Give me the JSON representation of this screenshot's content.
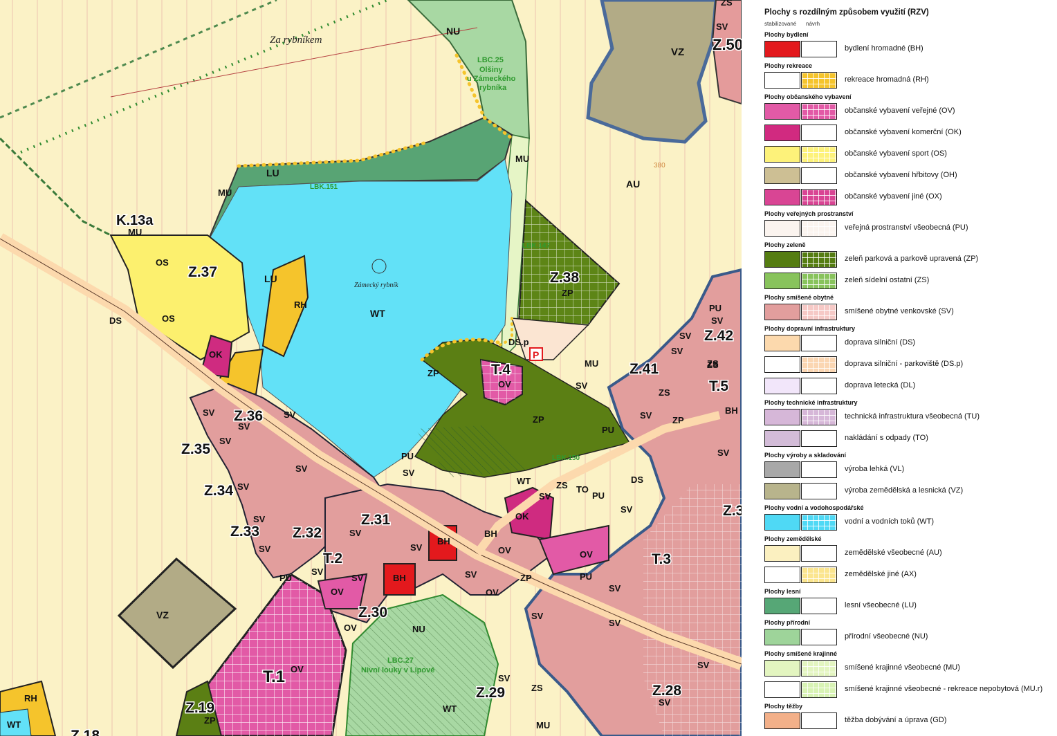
{
  "map": {
    "labels": {
      "za_rybnikem": "Za rybníkem",
      "nu_top": "NU",
      "lbc25": "LBC.25",
      "lbc25_name1": "Olšiny",
      "lbc25_name2": "u Zámeckého",
      "lbc25_name3": "rybníka",
      "vz_top": "VZ",
      "z50": "Z.50",
      "sv_top1": "SV",
      "zs_top": "ZS",
      "mu_1": "MU",
      "mu_2": "MU",
      "mu_3": "MU",
      "mu_4": "MU",
      "lu_1": "LU",
      "lu_2": "LU",
      "lbk151": "LBK.151",
      "k13a": "K.13a",
      "au": "AU",
      "contour380": "380",
      "lbk147": "LBK.147",
      "z38": "Z.38",
      "zp_z38": "ZP",
      "os_1": "OS",
      "os_2": "OS",
      "z37": "Z.37",
      "rh_1": "RH",
      "wt_main": "WT",
      "zamecky": "Zámecký rybník",
      "ds_1": "DS",
      "ok_1": "OK",
      "dsp": "DS.p",
      "p_icon_text": "P",
      "zp_1": "ZP",
      "t4": "T.4",
      "ov_t4": "OV",
      "mu_5": "MU",
      "sv_a": "SV",
      "zp_big": "ZP",
      "z41": "Z.41",
      "z42": "Z.42",
      "pu_r1": "PU",
      "sv_r1": "SV",
      "sv_r2": "SV",
      "sv_r3": "SV",
      "zs_r1": "ZS",
      "zs_r2": "ZS",
      "t5": "T.5",
      "bh_r1": "BH",
      "zp_r1": "ZP",
      "sv_r4": "SV",
      "z36": "Z.36",
      "z35": "Z.35",
      "z34": "Z.34",
      "z33": "Z.33",
      "z32": "Z.32",
      "z31": "Z.31",
      "t2": "T.2",
      "z30": "Z.30",
      "t1": "T.1",
      "z29": "Z.29",
      "z28": "Z.28",
      "t3": "T.3",
      "z19": "Z.19",
      "z18": "Z.18",
      "lbk150": "LBK.150",
      "lbc27": "LBC.27",
      "lbc27_name": "Nivní louky v Lipové",
      "pu_1": "PU",
      "pu_2": "PU",
      "pu_3": "PU",
      "pu_4": "PU",
      "pu_5": "PU",
      "sv_1": "SV",
      "sv_2": "SV",
      "sv_3": "SV",
      "sv_4": "SV",
      "sv_5": "SV",
      "sv_6": "SV",
      "sv_7": "SV",
      "sv_8": "SV",
      "sv_9": "SV",
      "sv_10": "SV",
      "sv_11": "SV",
      "sv_12": "SV",
      "sv_13": "SV",
      "sv_14": "SV",
      "sv_15": "SV",
      "sv_16": "SV",
      "sv_17": "SV",
      "sv_18": "SV",
      "sv_19": "SV",
      "sv_20": "SV",
      "sv_21": "SV",
      "sv_22": "SV",
      "sv_23": "SV",
      "wt_2": "WT",
      "wt_3": "WT",
      "wt_4": "WT",
      "zs_1": "ZS",
      "zs_2": "ZS",
      "to_1": "TO",
      "ds_2": "DS",
      "ok_2": "OK",
      "bh_1": "BH",
      "bh_2": "BH",
      "bh_3": "BH",
      "ov_1": "OV",
      "ov_2": "OV",
      "ov_3": "OV",
      "ov_4": "OV",
      "ov_5": "OV",
      "ov_6": "OV",
      "zp_2": "ZP",
      "zp_3": "ZP",
      "vz_2": "VZ",
      "nu_2": "NU",
      "rh_2": "RH",
      "mu_6": "MU",
      "zs_3": "ZS",
      "z3x": "Z.3"
    }
  },
  "legend": {
    "title": "Plochy s rozdílným způsobem využití (RZV)",
    "col_stab": "stabilizované",
    "col_navrh": "návrh",
    "groups": [
      {
        "heading": "Plochy bydlení",
        "rows": [
          {
            "label": "bydlení hromadné (BH)",
            "a": "#e3191d",
            "b": "#ffffff",
            "bgrid": false
          }
        ]
      },
      {
        "heading": "Plochy rekreace",
        "rows": [
          {
            "label": "rekreace hromadná (RH)",
            "a": "#ffffff",
            "b": "#f5c42c",
            "bgrid": true
          }
        ]
      },
      {
        "heading": "Plochy občanského vybavení",
        "rows": [
          {
            "label": "občanské vybavení veřejné (OV)",
            "a": "#e25aa6",
            "b": "#e25aa6",
            "bgrid": true
          },
          {
            "label": "občanské vybavení komerční (OK)",
            "a": "#d12a80",
            "b": "#ffffff",
            "bgrid": false
          },
          {
            "label": "občanské vybavení sport (OS)",
            "a": "#fdf27a",
            "b": "#fdf27a",
            "bgrid": true
          },
          {
            "label": "občanské vybavení hřbitovy (OH)",
            "a": "#cdbf94",
            "b": "#ffffff",
            "bgrid": false
          },
          {
            "label": "občanské vybavení jiné (OX)",
            "a": "#d94594",
            "b": "#d94594",
            "bgrid": true
          }
        ]
      },
      {
        "heading": "Plochy veřejných prostranství",
        "rows": [
          {
            "label": "veřejná prostranství všeobecná (PU)",
            "a": "#fbf4ef",
            "b": "#fbf4ef",
            "bgrid": true
          }
        ]
      },
      {
        "heading": "Plochy zeleně",
        "rows": [
          {
            "label": "zeleň parková a parkově upravená (ZP)",
            "a": "#557d12",
            "b": "#557d12",
            "bgrid": true
          },
          {
            "label": "zeleň sídelní ostatní (ZS)",
            "a": "#88c35c",
            "b": "#88c35c",
            "bgrid": true
          }
        ]
      },
      {
        "heading": "Plochy smíšené obytné",
        "rows": [
          {
            "label": "smíšené obytné venkovské (SV)",
            "a": "#e29e9d",
            "b": "#f6c9c6",
            "bgrid": true
          }
        ]
      },
      {
        "heading": "Plochy dopravní infrastruktury",
        "rows": [
          {
            "label": "doprava silniční (DS)",
            "a": "#fcd9ad",
            "b": "#ffffff",
            "bgrid": false
          },
          {
            "label": "doprava silniční - parkoviště (DS.p)",
            "a": "#ffffff",
            "b": "#fbd6b2",
            "bgrid": true
          },
          {
            "label": "doprava letecká (DL)",
            "a": "#f2e6fa",
            "b": "#ffffff",
            "bgrid": false
          }
        ]
      },
      {
        "heading": "Plochy technické infrastruktury",
        "rows": [
          {
            "label": "technická infrastruktura všeobecná (TU)",
            "a": "#d6b7d8",
            "b": "#d6b7d8",
            "bgrid": true
          },
          {
            "label": "nakládání s odpady (TO)",
            "a": "#d3bcd8",
            "b": "#ffffff",
            "bgrid": false
          }
        ]
      },
      {
        "heading": "Plochy výroby a skladování",
        "rows": [
          {
            "label": "výroba lehká (VL)",
            "a": "#a8a8a8",
            "b": "#ffffff",
            "bgrid": false
          },
          {
            "label": "výroba zemědělská a lesnická (VZ)",
            "a": "#b8b48c",
            "b": "#ffffff",
            "bgrid": false
          }
        ]
      },
      {
        "heading": "Plochy vodní a vodohospodářské",
        "rows": [
          {
            "label": "vodní a vodních toků (WT)",
            "a": "#4fd9f5",
            "b": "#4fd9f5",
            "bgrid": true
          }
        ]
      },
      {
        "heading": "Plochy zemědělské",
        "rows": [
          {
            "label": "zemědělské všeobecné (AU)",
            "a": "#fbf0c0",
            "b": "#ffffff",
            "bgrid": false
          },
          {
            "label": "zemědělské jiné (AX)",
            "a": "#ffffff",
            "b": "#fbe58e",
            "bgrid": true
          }
        ]
      },
      {
        "heading": "Plochy lesní",
        "rows": [
          {
            "label": "lesní všeobecné (LU)",
            "a": "#56a776",
            "b": "#ffffff",
            "bgrid": false
          }
        ]
      },
      {
        "heading": "Plochy přírodní",
        "rows": [
          {
            "label": "přírodní všeobecné (NU)",
            "a": "#9ed49a",
            "b": "#ffffff",
            "bgrid": false
          }
        ]
      },
      {
        "heading": "Plochy smíšené krajinné",
        "rows": [
          {
            "label": "smíšené krajinné všeobecné (MU)",
            "a": "#e3f5c0",
            "b": "#e3f5c0",
            "bgrid": true
          },
          {
            "label": "smíšené krajinné všeobecné - rekreace nepobytová (MU.r)",
            "a": "#ffffff",
            "b": "#d8f3b4",
            "bgrid": true
          }
        ]
      },
      {
        "heading": "Plochy těžby",
        "rows": [
          {
            "label": "těžba dobývání a úprava (GD)",
            "a": "#f3b089",
            "b": "#ffffff",
            "bgrid": false
          }
        ]
      }
    ]
  }
}
